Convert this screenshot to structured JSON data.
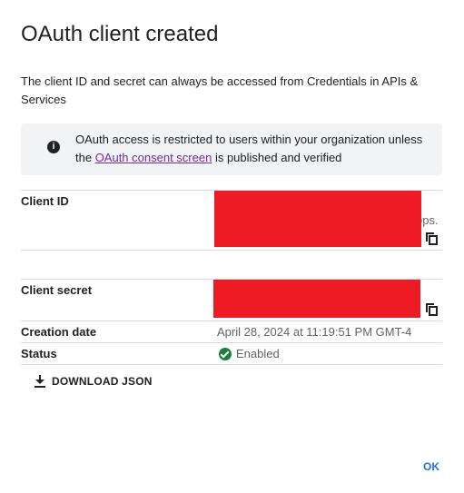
{
  "dialog": {
    "title": "OAuth client created",
    "description": "The client ID and secret can always be accessed from Credentials in APIs & Services"
  },
  "notice": {
    "icon": "info-icon",
    "text_before": "OAuth access is restricted to users within your organization unless the ",
    "link_text": "OAuth consent screen",
    "text_after": " is published and verified"
  },
  "fields": {
    "client_id_label": "Client ID",
    "client_id_visible_suffix": "ops.",
    "client_secret_label": "Client secret",
    "creation_date_label": "Creation date",
    "creation_date_value": "April 28, 2024 at 11:19:51 PM GMT-4",
    "status_label": "Status",
    "status_value": "Enabled"
  },
  "actions": {
    "download_label": "DOWNLOAD JSON",
    "ok_label": "OK"
  },
  "colors": {
    "accent": "#1a73e8",
    "link": "#6f2da8",
    "status_ok": "#188038",
    "redaction": "#ed1c24"
  }
}
